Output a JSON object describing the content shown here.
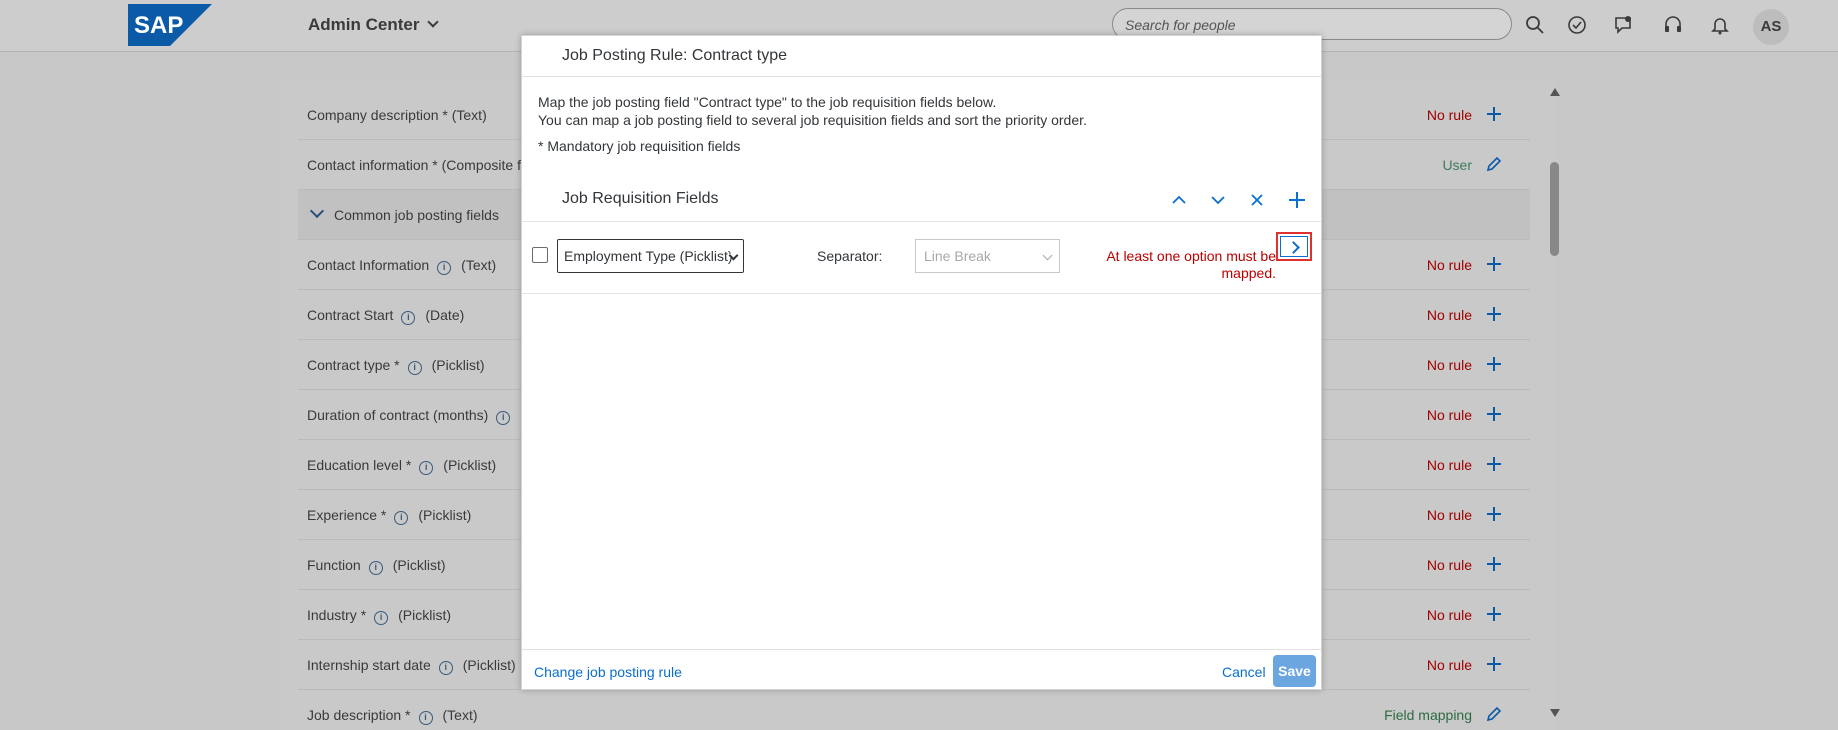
{
  "shell": {
    "logo_text": "SAP",
    "app_title": "Admin Center",
    "search_placeholder": "Search for people",
    "avatar_initials": "AS"
  },
  "background": {
    "rows": [
      {
        "label": "Company description * (Text)",
        "status": "No rule",
        "action": "plus"
      },
      {
        "label": "Contact information * (Composite f",
        "status": "User",
        "action": "pencil"
      },
      {
        "label": "Common job posting fields",
        "group": true
      },
      {
        "label": "Contact Information",
        "suffix": "(Text)",
        "status": "No rule",
        "action": "plus"
      },
      {
        "label": "Contract Start",
        "suffix": "(Date)",
        "status": "No rule",
        "action": "plus"
      },
      {
        "label": "Contract type *",
        "suffix": "(Picklist)",
        "status": "No rule",
        "action": "plus"
      },
      {
        "label": "Duration of contract (months)",
        "suffix": "",
        "status": "No rule",
        "action": "plus"
      },
      {
        "label": "Education level *",
        "suffix": "(Picklist)",
        "status": "No rule",
        "action": "plus"
      },
      {
        "label": "Experience *",
        "suffix": "(Picklist)",
        "status": "No rule",
        "action": "plus"
      },
      {
        "label": "Function",
        "suffix": "(Picklist)",
        "status": "No rule",
        "action": "plus"
      },
      {
        "label": "Industry *",
        "suffix": "(Picklist)",
        "status": "No rule",
        "action": "plus"
      },
      {
        "label": "Internship start date",
        "suffix": "(Picklist)",
        "status": "No rule",
        "action": "plus"
      },
      {
        "label": "Job description *",
        "suffix": "(Text)",
        "status": "Field mapping",
        "action": "pencil"
      }
    ]
  },
  "dialog": {
    "title": "Job Posting Rule: Contract type",
    "intro_line1": "Map the job posting field \"Contract type\" to the job requisition fields below.",
    "intro_line2": "You can map a job posting field to several job requisition fields and sort the priority order.",
    "mandatory_note": "* Mandatory job requisition fields",
    "section_title": "Job Requisition Fields",
    "field_select_value": "Employment Type (Picklist)",
    "separator_label": "Separator:",
    "separator_value": "Line Break",
    "error_text": "At least one option must be mapped.",
    "change_rule_link": "Change job posting rule",
    "cancel_label": "Cancel",
    "save_label": "Save"
  },
  "colors": {
    "accent": "#0a6ed1",
    "error": "#bb0000",
    "highlight": "#e03131"
  }
}
